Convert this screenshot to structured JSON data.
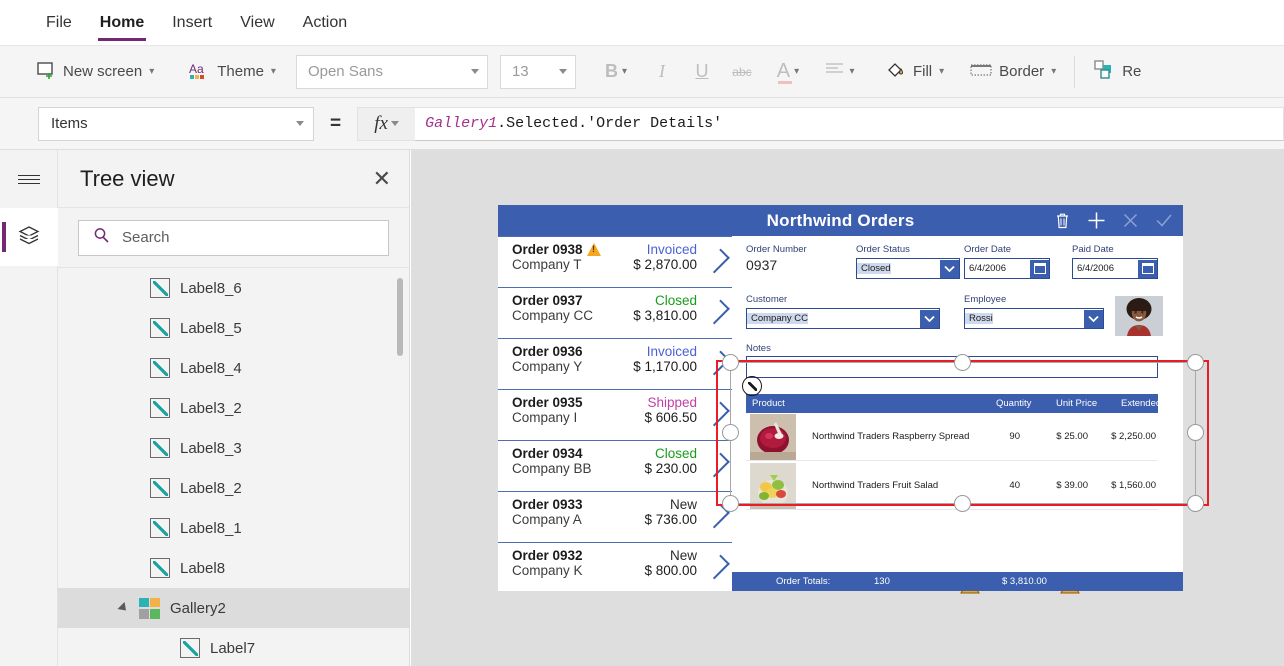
{
  "menu": {
    "items": [
      {
        "label": "File",
        "active": false
      },
      {
        "label": "Home",
        "active": true
      },
      {
        "label": "Insert",
        "active": false
      },
      {
        "label": "View",
        "active": false
      },
      {
        "label": "Action",
        "active": false
      }
    ]
  },
  "ribbon": {
    "new_screen": "New screen",
    "theme": "Theme",
    "font_family": "Open Sans",
    "font_size": "13",
    "bold": "B",
    "italic": "I",
    "underline": "U",
    "strikethrough": "abc",
    "font_color": "A",
    "align": "align-icon",
    "fill": "Fill",
    "border": "Border",
    "reorder": "Re"
  },
  "formula_bar": {
    "property": "Items",
    "equals": "=",
    "fx": "fx",
    "formula_prefix": "Gallery1",
    "formula_rest": ".Selected.'Order Details'"
  },
  "tree_view": {
    "title": "Tree view",
    "close": "✕",
    "search_placeholder": "Search",
    "search_value": "",
    "items": [
      {
        "label": "Label8_6",
        "icon": "label-icon",
        "type": "label",
        "selected": false,
        "child": false
      },
      {
        "label": "Label8_5",
        "icon": "label-icon",
        "type": "label",
        "selected": false,
        "child": false
      },
      {
        "label": "Label8_4",
        "icon": "label-icon",
        "type": "label",
        "selected": false,
        "child": false
      },
      {
        "label": "Label3_2",
        "icon": "label-icon",
        "type": "label",
        "selected": false,
        "child": false
      },
      {
        "label": "Label8_3",
        "icon": "label-icon",
        "type": "label",
        "selected": false,
        "child": false
      },
      {
        "label": "Label8_2",
        "icon": "label-icon",
        "type": "label",
        "selected": false,
        "child": false
      },
      {
        "label": "Label8_1",
        "icon": "label-icon",
        "type": "label",
        "selected": false,
        "child": false
      },
      {
        "label": "Label8",
        "icon": "label-icon",
        "type": "label",
        "selected": false,
        "child": false
      },
      {
        "label": "Gallery2",
        "icon": "gallery-icon",
        "type": "gallery",
        "selected": true,
        "child": false
      },
      {
        "label": "Label7",
        "icon": "label-icon",
        "type": "label",
        "selected": false,
        "child": true
      }
    ]
  },
  "app": {
    "title": "Northwind Orders",
    "header_icons": [
      "trash-icon",
      "plus-icon",
      "cancel-icon",
      "check-icon"
    ],
    "orders": [
      {
        "id": "Order 0938",
        "company": "Company T",
        "status": "Invoiced",
        "status_color": "#4b5fd6",
        "amount": "$ 2,870.00",
        "warning": true
      },
      {
        "id": "Order 0937",
        "company": "Company CC",
        "status": "Closed",
        "status_color": "#1a9c1a",
        "amount": "$ 3,810.00",
        "warning": false
      },
      {
        "id": "Order 0936",
        "company": "Company Y",
        "status": "Invoiced",
        "status_color": "#4b5fd6",
        "amount": "$ 1,170.00",
        "warning": false
      },
      {
        "id": "Order 0935",
        "company": "Company I",
        "status": "Shipped",
        "status_color": "#c13fa5",
        "amount": "$ 606.50",
        "warning": false
      },
      {
        "id": "Order 0934",
        "company": "Company BB",
        "status": "Closed",
        "status_color": "#1a9c1a",
        "amount": "$ 230.00",
        "warning": false
      },
      {
        "id": "Order 0933",
        "company": "Company A",
        "status": "New",
        "status_color": "#2a2a2a",
        "amount": "$ 736.00",
        "warning": false
      },
      {
        "id": "Order 0932",
        "company": "Company K",
        "status": "New",
        "status_color": "#2a2a2a",
        "amount": "$ 800.00",
        "warning": false
      }
    ],
    "form": {
      "order_number_label": "Order Number",
      "order_number_value": "0937",
      "order_status_label": "Order Status",
      "order_status_value": "Closed",
      "order_date_label": "Order Date",
      "order_date_value": "6/4/2006",
      "paid_date_label": "Paid Date",
      "paid_date_value": "6/4/2006",
      "customer_label": "Customer",
      "customer_value": "Company CC",
      "employee_label": "Employee",
      "employee_value": "Rossi",
      "notes_label": "Notes",
      "notes_value": ""
    },
    "product_gallery": {
      "columns": [
        "Product",
        "Quantity",
        "Unit Price",
        "Extended"
      ],
      "rows": [
        {
          "product": "Northwind Traders Raspberry Spread",
          "quantity": "90",
          "unit_price": "$ 25.00",
          "extended": "$ 2,250.00",
          "thumb": "raspberry-spread-image"
        },
        {
          "product": "Northwind Traders Fruit Salad",
          "quantity": "40",
          "unit_price": "$ 39.00",
          "extended": "$ 1,560.00",
          "thumb": "fruit-salad-image"
        }
      ]
    },
    "totals": {
      "label": "Order Totals:",
      "quantity": "130",
      "amount": "$ 3,810.00"
    }
  },
  "colors": {
    "accent_purple": "#742774",
    "app_blue": "#3b5fae",
    "selection_red": "#ec1c24",
    "warning_orange": "#f5a623"
  }
}
